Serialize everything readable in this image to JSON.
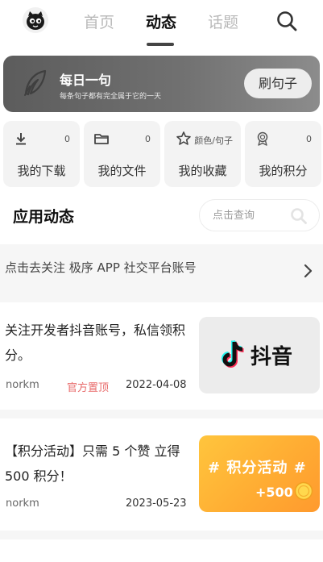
{
  "header": {
    "tabs": [
      {
        "label": "首页",
        "active": false
      },
      {
        "label": "动态",
        "active": true
      },
      {
        "label": "话题",
        "active": false
      }
    ],
    "avatar_icon": "cartoon-mascot-icon",
    "search_icon": "search-icon"
  },
  "banner": {
    "title": "每日一句",
    "subtitle": "每条句子都有完全属于它的一天",
    "button_label": "刷句子",
    "icon": "quill-icon"
  },
  "cards": [
    {
      "label": "我的下载",
      "count": "0",
      "icon": "download-icon"
    },
    {
      "label": "我的文件",
      "count": "0",
      "icon": "folder-icon"
    },
    {
      "label": "我的收藏",
      "count": "颜色/句子",
      "icon": "star-icon"
    },
    {
      "label": "我的积分",
      "count": "0",
      "icon": "award-icon"
    }
  ],
  "section": {
    "title": "应用动态",
    "search_placeholder": "点击查询"
  },
  "follow_bar": {
    "text": "点击去关注 极序 APP 社交平台账号"
  },
  "posts": [
    {
      "title": "关注开发者抖音账号，私信领积分。",
      "author": "norkm",
      "tag": "官方置顶",
      "date": "2022-04-08",
      "thumb_text": "抖音"
    },
    {
      "title": "【积分活动】只需 5 个赞 立得 500 积分！",
      "author": "norkm",
      "tag": "",
      "date": "2023-05-23",
      "thumb_text": "# 积分活动 #",
      "thumb_sub": "+500"
    }
  ],
  "colors": {
    "accent_red": "#e86a6a",
    "banner_gray": "#646464",
    "card_bg": "#f3f3f3",
    "activity_orange": "#ffb233"
  }
}
